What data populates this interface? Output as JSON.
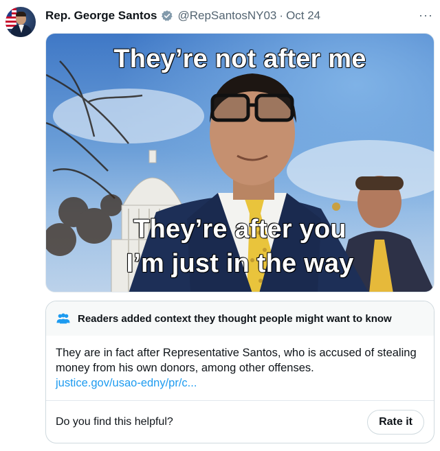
{
  "tweet": {
    "author_name": "Rep. George Santos",
    "handle": "@RepSantosNY03",
    "separator": "·",
    "date": "Oct 24",
    "more_label": "···",
    "verified_icon": "verified-badge-icon",
    "verified_color": "#829aab"
  },
  "media": {
    "caption_top": "They’re not after me",
    "caption_middle": "They’re after you",
    "caption_bottom": "I’m just in the way"
  },
  "community_note": {
    "header_icon": "people-icon",
    "header_text": "Readers added context they thought people might want to know",
    "body_text": "They are in fact after Representative Santos, who is accused of stealing money from his own donors, among other offenses.",
    "link_text": "justice.gov/usao-edny/pr/c...",
    "question": "Do you find this helpful?",
    "rate_button": "Rate it",
    "accent_color": "#1d9bf0"
  }
}
